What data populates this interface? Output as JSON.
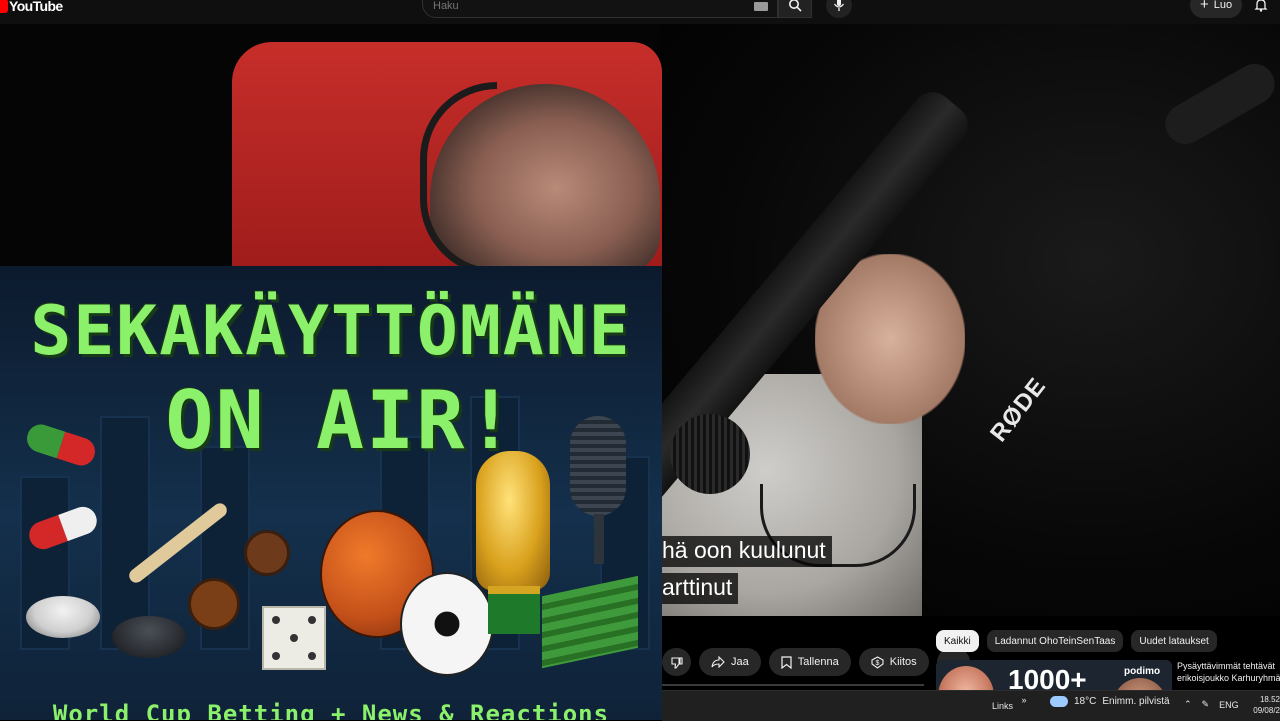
{
  "topbar": {
    "logo_text": "YouTube",
    "search_placeholder": "Haku",
    "create_label": "Luo"
  },
  "thumbnail": {
    "title_line1": "SEKAKÄYTTÖMÄNE",
    "title_line2": "ON AIR!",
    "caption": "World Cup Betting + News & Reactions"
  },
  "video": {
    "mic_brand": "RØDE",
    "subtitle_line1": "hä oon kuulunut",
    "subtitle_line2": "arttinut"
  },
  "actions": {
    "share": "Jaa",
    "save": "Tallenna",
    "thanks": "Kiitos"
  },
  "chips": [
    "Kaikki",
    "Ladannut OhoTeinSenTaas",
    "Uudet lataukset"
  ],
  "recommendation": {
    "thumb_text": "1000+",
    "thumb_brand": "podimo",
    "title_line1": "Pysäyttävimmät tehtävät",
    "title_line2": "erikoisjoukko Karhuryhmä"
  },
  "taskbar": {
    "links_label": "Links",
    "temperature": "18°C",
    "weather_desc": "Enimm. pilvistä",
    "language": "ENG",
    "time": "18.52",
    "date": "09/08/2"
  },
  "colors": {
    "youtube_red": "#ff0000",
    "thumbnail_text_green": "#8cf16a",
    "chair_red": "#c72e2a"
  }
}
